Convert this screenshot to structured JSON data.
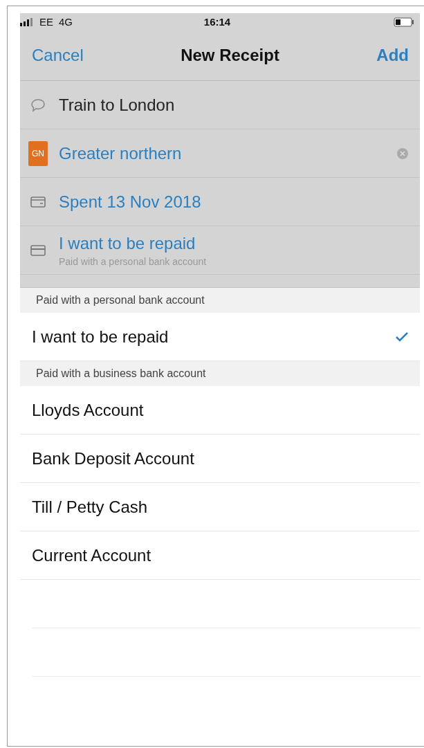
{
  "status_bar": {
    "carrier": "EE",
    "network": "4G",
    "time": "16:14"
  },
  "nav": {
    "cancel": "Cancel",
    "title": "New Receipt",
    "add": "Add"
  },
  "form_rows": [
    {
      "kind": "note",
      "text": "Train to London"
    },
    {
      "kind": "supplier",
      "badge": "GN",
      "text": "Greater northern"
    },
    {
      "kind": "date",
      "text": "Spent 13 Nov 2018"
    },
    {
      "kind": "payment",
      "text": "I want to be repaid",
      "subtitle": "Paid with a personal bank account"
    }
  ],
  "sections": [
    {
      "header": "Paid with a personal bank account",
      "items": [
        {
          "label": "I want to be repaid",
          "selected": true
        }
      ]
    },
    {
      "header": "Paid with a business bank account",
      "items": [
        {
          "label": "Lloyds Account",
          "selected": false
        },
        {
          "label": "Bank Deposit Account",
          "selected": false
        },
        {
          "label": "Till / Petty Cash",
          "selected": false
        },
        {
          "label": "Current Account",
          "selected": false
        }
      ]
    }
  ]
}
